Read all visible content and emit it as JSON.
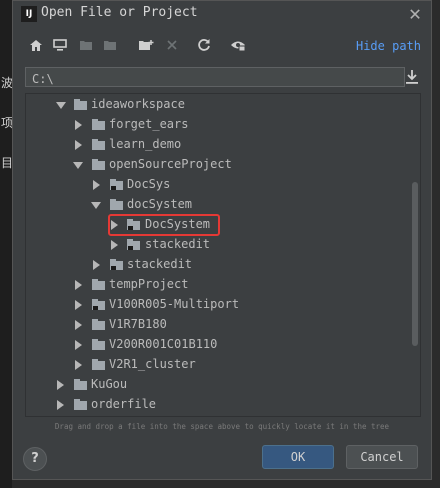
{
  "dialog": {
    "title": "Open File or Project",
    "app_icon_text": "IJ"
  },
  "toolbar": {
    "icons": [
      "home-icon",
      "desktop-icon",
      "project-folder-icon",
      "module-folder-icon",
      "new-folder-icon",
      "delete-icon",
      "refresh-icon",
      "show-hidden-icon"
    ],
    "hide_path_label": "Hide path"
  },
  "path": {
    "value": "C:\\"
  },
  "tree": {
    "items": [
      {
        "label": "ideaworkspace",
        "expanded": true
      },
      {
        "label": "forget_ears",
        "expanded": false
      },
      {
        "label": "learn_demo",
        "expanded": false
      },
      {
        "label": "openSourceProject",
        "expanded": true
      },
      {
        "label": "DocSys",
        "expanded": false
      },
      {
        "label": "docSystem",
        "expanded": true
      },
      {
        "label": "DocSystem",
        "expanded": false,
        "highlighted": true
      },
      {
        "label": "stackedit",
        "expanded": false
      },
      {
        "label": "stackedit",
        "expanded": false
      },
      {
        "label": "tempProject",
        "expanded": false
      },
      {
        "label": "V100R005-Multiport",
        "expanded": false
      },
      {
        "label": "V1R7B180",
        "expanded": false
      },
      {
        "label": "V200R001C01B110",
        "expanded": false
      },
      {
        "label": "V2R1_cluster",
        "expanded": false
      },
      {
        "label": "KuGou",
        "expanded": false
      },
      {
        "label": "orderfile",
        "expanded": false
      }
    ]
  },
  "hint": "Drag and drop a file into the space above to quickly locate it in the tree",
  "buttons": {
    "help": "?",
    "ok": "OK",
    "cancel": "Cancel"
  },
  "colors": {
    "highlight_border": "#e53935",
    "link": "#589df6",
    "ok_button": "#365880"
  }
}
